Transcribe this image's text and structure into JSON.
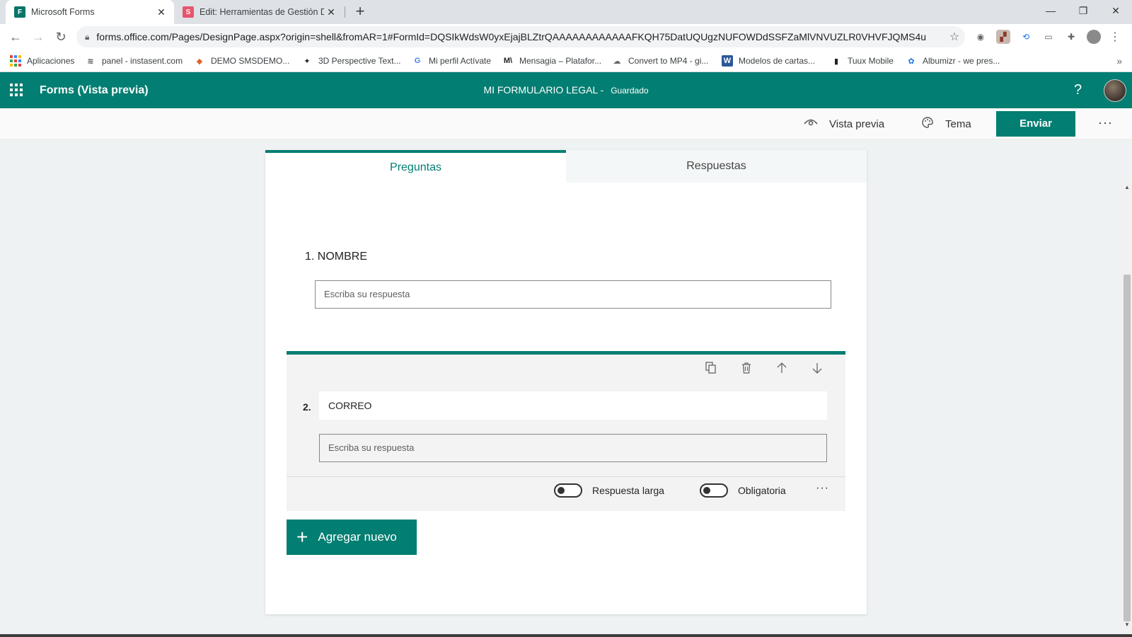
{
  "browser": {
    "tabs": [
      {
        "title": "Microsoft Forms",
        "favicon": "F"
      },
      {
        "title": "Edit: Herramientas de Gestión Di",
        "favicon": "S"
      }
    ],
    "url": "forms.office.com/Pages/DesignPage.aspx?origin=shell&fromAR=1#FormId=DQSIkWdsW0yxEjajBLZtrQAAAAAAAAAAAAFKQH75DatUQUgzNUFOWDdSSFZaMlVNVUZLR0VHVFJQMS4u",
    "bookmarks": [
      {
        "label": "Aplicaciones",
        "icon": "apps-grid-icon"
      },
      {
        "label": "panel - instasent.com",
        "icon": "instasent-icon"
      },
      {
        "label": "DEMO SMSDEMO...",
        "icon": "sms-demo-icon"
      },
      {
        "label": "3D Perspective Text...",
        "icon": "3d-text-icon"
      },
      {
        "label": "Mi perfil Actívate",
        "icon": "google-icon"
      },
      {
        "label": "Mensagia – Platafor...",
        "icon": "mensagia-icon"
      },
      {
        "label": "Convert to MP4 - gi...",
        "icon": "convert-icon"
      },
      {
        "label": "Modelos de cartas...",
        "icon": "word-icon"
      },
      {
        "label": "Tuux Mobile",
        "icon": "tuux-icon"
      },
      {
        "label": "Albumizr - we pres...",
        "icon": "albumizr-icon"
      }
    ]
  },
  "header": {
    "app_name": "Forms (Vista previa)",
    "form_title": "MI FORMULARIO LEGAL",
    "separator": " - ",
    "status": "Guardado",
    "help": "?"
  },
  "commands": {
    "preview": "Vista previa",
    "theme": "Tema",
    "send": "Enviar",
    "more": "···"
  },
  "tabs": {
    "questions": "Preguntas",
    "responses": "Respuestas"
  },
  "questions": [
    {
      "number": "1.",
      "title": "NOMBRE",
      "placeholder": "Escriba su respuesta"
    },
    {
      "number": "2.",
      "title": "CORREO",
      "placeholder": "Escriba su respuesta"
    }
  ],
  "question_options": {
    "long_answer": "Respuesta larga",
    "required": "Obligatoria",
    "more": "···"
  },
  "add_new": "Agregar nuevo",
  "colors": {
    "accent": "#037e72",
    "page_bg": "#eef2f2"
  }
}
